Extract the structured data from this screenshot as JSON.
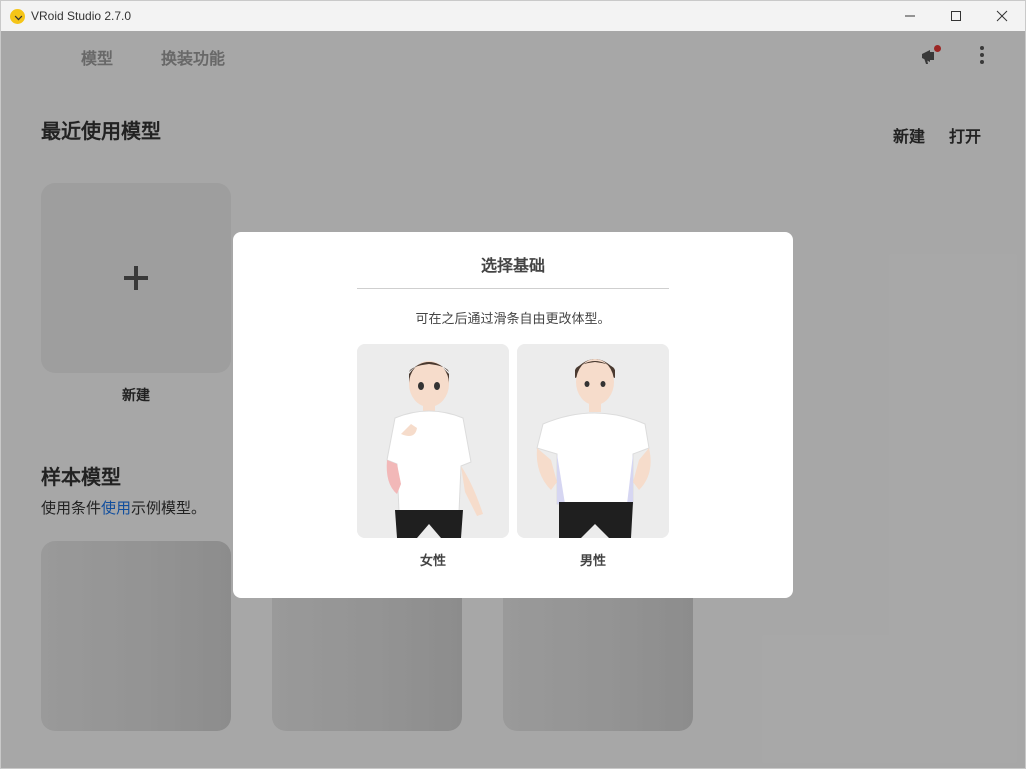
{
  "window": {
    "title": "VRoid Studio 2.7.0"
  },
  "nav": {
    "tabs": [
      "模型",
      "换装功能"
    ]
  },
  "recent": {
    "title": "最近使用模型",
    "new_label": "新建",
    "open_label": "打开",
    "new_card_label": "新建"
  },
  "samples": {
    "title": "样本模型",
    "desc_before": "使用条件",
    "desc_link": "使用",
    "desc_after": "示例模型。"
  },
  "modal": {
    "title": "选择基础",
    "description": "可在之后通过滑条自由更改体型。",
    "options": [
      {
        "label": "女性"
      },
      {
        "label": "男性"
      }
    ]
  },
  "colors": {
    "link": "#1a73e8",
    "notification_dot": "#e53935",
    "logo": "#f5c518"
  },
  "icons": [
    "app-logo-icon",
    "minimize-icon",
    "maximize-icon",
    "close-icon",
    "notification-icon",
    "more-vertical-icon",
    "plus-icon"
  ]
}
